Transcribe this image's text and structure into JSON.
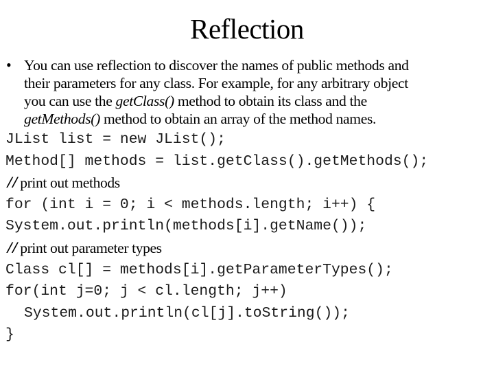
{
  "slide": {
    "title": "Reflection",
    "bullet": {
      "icon": "bullet-dot",
      "glyph": "•",
      "lines": [
        {
          "before": "You can use reflection to discover the names of public methods and",
          "italic": "",
          "after": ""
        },
        {
          "before": "their parameters for any class. For example, for any arbitrary object",
          "italic": "",
          "after": ""
        },
        {
          "before": "you can use the ",
          "italic": "getClass()",
          "after": " method to obtain its class and the"
        },
        {
          "before": "",
          "italic": "getMethods()",
          "after": " method to obtain an array of the method names."
        }
      ]
    },
    "code": [
      {
        "type": "code",
        "indent": false,
        "text": "JList list = new JList();"
      },
      {
        "type": "code",
        "indent": false,
        "text": "Method[] methods = list.getClass().getMethods();"
      },
      {
        "type": "comment",
        "slashes": "//",
        "text": "print out methods"
      },
      {
        "type": "code",
        "indent": false,
        "text": "for (int i = 0; i < methods.length; i++) {"
      },
      {
        "type": "code",
        "indent": false,
        "text": "System.out.println(methods[i].getName());"
      },
      {
        "type": "comment",
        "slashes": "//",
        "text": "print out parameter types"
      },
      {
        "type": "code",
        "indent": false,
        "text": "Class cl[] = methods[i].getParameterTypes();"
      },
      {
        "type": "code",
        "indent": false,
        "text": "for(int j=0; j < cl.length; j++)"
      },
      {
        "type": "code",
        "indent": true,
        "text": "System.out.println(cl[j].toString());"
      },
      {
        "type": "code",
        "indent": false,
        "text": "}"
      }
    ]
  }
}
